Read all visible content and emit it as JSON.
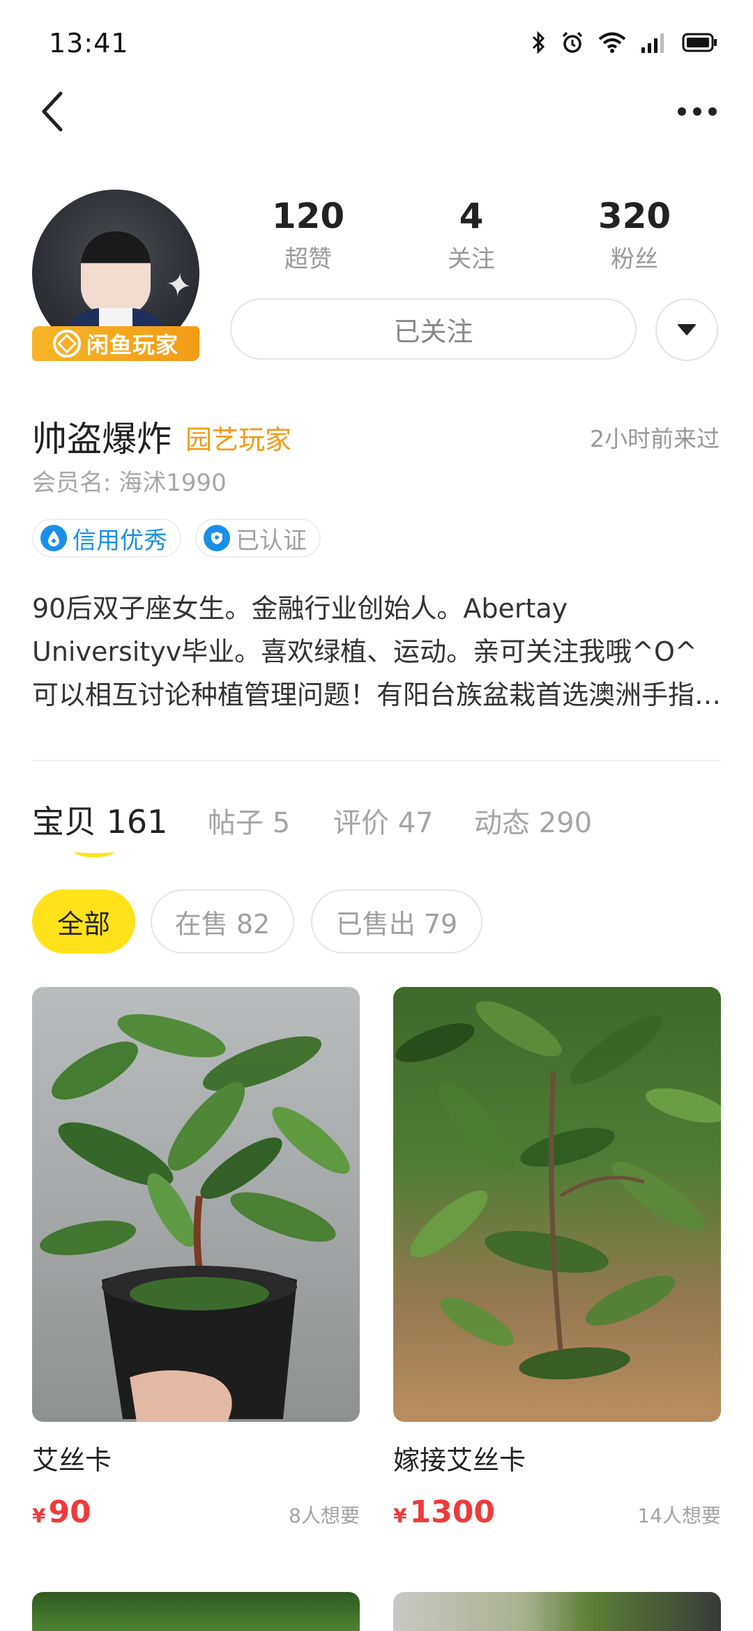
{
  "status_bar": {
    "time": "13:41",
    "network": "4G"
  },
  "nav": {
    "back_icon": "chevron-left-icon",
    "more_icon": "more-horizontal-icon"
  },
  "profile": {
    "avatar_badge": "闲鱼玩家",
    "stats": [
      {
        "value": "120",
        "label": "超赞"
      },
      {
        "value": "4",
        "label": "关注"
      },
      {
        "value": "320",
        "label": "粉丝"
      }
    ],
    "follow_button": "已关注",
    "name": "帅盗爆炸",
    "tag": "园艺玩家",
    "last_seen": "2小时前来过",
    "member_name": "会员名: 海沭1990",
    "badges": [
      {
        "label": "信用优秀"
      },
      {
        "label": "已认证"
      }
    ],
    "bio": "90后双子座女生。金融行业创始人。Abertay Universityv毕业。喜欢绿植、运动。亲可关注我哦^O^可以相互讨论种植管理问题！有阳台族盆栽首选澳洲手指柠檬及台…"
  },
  "tabs": [
    {
      "label": "宝贝 161"
    },
    {
      "label": "帖子 5"
    },
    {
      "label": "评价 47"
    },
    {
      "label": "动态 290"
    }
  ],
  "filters": [
    {
      "label": "全部"
    },
    {
      "label": "在售 82"
    },
    {
      "label": "已售出 79"
    }
  ],
  "products": [
    {
      "title": "艾丝卡",
      "currency": "¥",
      "price": "90",
      "wants": "8人想要"
    },
    {
      "title": "嫁接艾丝卡",
      "currency": "¥",
      "price": "1300",
      "wants": "14人想要"
    }
  ],
  "colors": {
    "accent_yellow": "#ffe21a",
    "tag_orange": "#f39b16",
    "credit_blue": "#1a8fe8",
    "price_red": "#ef3a3a"
  }
}
